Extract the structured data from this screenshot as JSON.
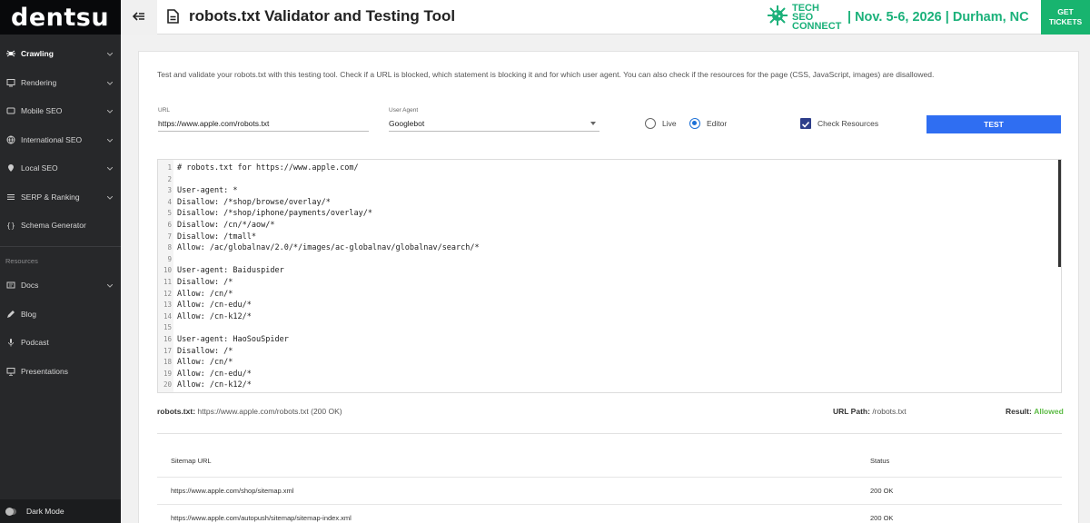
{
  "sidebar": {
    "logo": "dentsu",
    "items": [
      {
        "label": "Crawling",
        "icon": "spider-icon",
        "chevron": true,
        "active": true
      },
      {
        "label": "Rendering",
        "icon": "monitor-icon",
        "chevron": true
      },
      {
        "label": "Mobile SEO",
        "icon": "tablet-icon",
        "chevron": true
      },
      {
        "label": "International SEO",
        "icon": "globe-icon",
        "chevron": true
      },
      {
        "label": "Local SEO",
        "icon": "location-icon",
        "chevron": true
      },
      {
        "label": "SERP & Ranking",
        "icon": "list-icon",
        "chevron": true
      },
      {
        "label": "Schema Generator",
        "icon": "braces-icon",
        "chevron": false
      }
    ],
    "section_label": "Resources",
    "resources": [
      {
        "label": "Docs",
        "icon": "doc-icon",
        "chevron": true
      },
      {
        "label": "Blog",
        "icon": "pencil-icon",
        "chevron": false
      },
      {
        "label": "Podcast",
        "icon": "microphone-icon",
        "chevron": false
      },
      {
        "label": "Presentations",
        "icon": "screen-icon",
        "chevron": false
      }
    ],
    "dark_mode_label": "Dark Mode"
  },
  "header": {
    "title": "robots.txt Validator and Testing Tool",
    "promo_line1": "TECH SEO",
    "promo_line2": "CONNECT",
    "promo_event": "| Nov. 5-6, 2026 | Durham, NC",
    "tickets_line1": "GET",
    "tickets_line2": "TICKETS"
  },
  "main": {
    "intro": "Test and validate your robots.txt with this testing tool. Check if a URL is blocked, which statement is blocking it and for which user agent. You can also check if the resources for the page (CSS, JavaScript, images) are disallowed.",
    "url_label": "URL",
    "url_value": "https://www.apple.com/robots.txt",
    "ua_label": "User Agent",
    "ua_value": "Googlebot",
    "live_label": "Live",
    "editor_label": "Editor",
    "check_label": "Check Resources",
    "test_label": "TEST",
    "code_lines": [
      "# robots.txt for https://www.apple.com/",
      "",
      "User-agent: *",
      "Disallow: /*shop/browse/overlay/*",
      "Disallow: /*shop/iphone/payments/overlay/*",
      "Disallow: /cn/*/aow/*",
      "Disallow: /tmall*",
      "Allow: /ac/globalnav/2.0/*/images/ac-globalnav/globalnav/search/*",
      "",
      "User-agent: Baiduspider",
      "Disallow: /*",
      "Allow: /cn/*",
      "Allow: /cn-edu/*",
      "Allow: /cn-k12/*",
      "",
      "User-agent: HaoSouSpider",
      "Disallow: /*",
      "Allow: /cn/*",
      "Allow: /cn-edu/*",
      "Allow: /cn-k12/*"
    ],
    "robots_label": "robots.txt:",
    "robots_value": "https://www.apple.com/robots.txt (200 OK)",
    "path_label": "URL Path:",
    "path_value": "/robots.txt",
    "result_label": "Result:",
    "result_value": "Allowed",
    "table": {
      "headers": [
        "Sitemap URL",
        "Status"
      ],
      "rows": [
        [
          "https://www.apple.com/shop/sitemap.xml",
          "200 OK"
        ],
        [
          "https://www.apple.com/autopush/sitemap/sitemap-index.xml",
          "200 OK"
        ]
      ]
    }
  }
}
